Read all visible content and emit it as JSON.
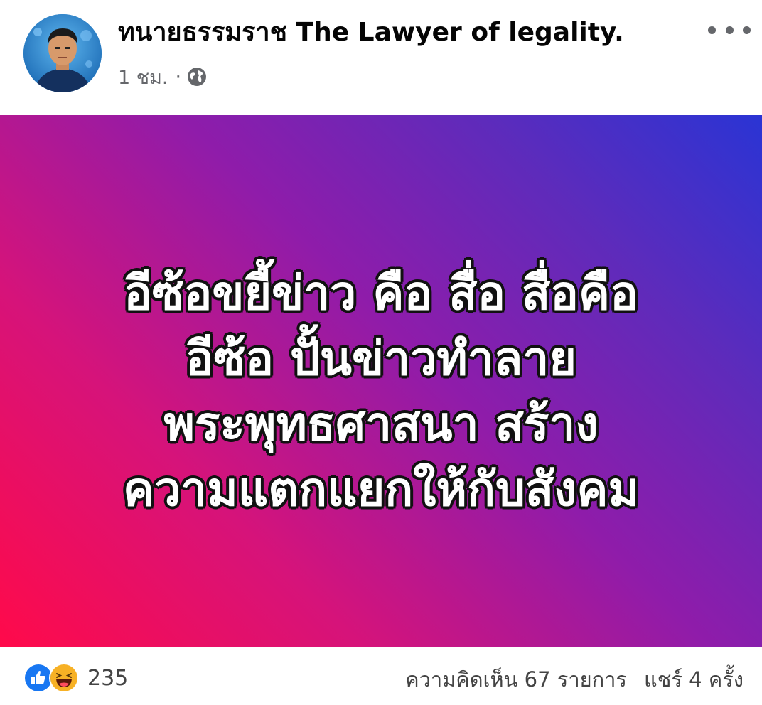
{
  "post": {
    "author_name": "ทนายธรรมราช The Lawyer of  legality.",
    "timestamp": "1 ชม.",
    "separator": "·",
    "audience_icon": "globe-icon",
    "more_icon": "more-options-icon",
    "background_gradient": [
      "#ff0a4a",
      "#8f1caa",
      "#2a34d4"
    ],
    "text_lines": [
      "อีซ้อขยี้ข่าว คือ สื่อ สื่อคือ",
      "อีซ้อ ปั้นข่าวทำลาย",
      "พระพุทธศาสนา สร้าง",
      "ความแตกแยกให้กับสังคม"
    ]
  },
  "footer": {
    "reaction_icons": [
      "like-icon",
      "haha-icon"
    ],
    "reaction_count": "235",
    "comments_text": "ความคิดเห็น 67 รายการ",
    "shares_text": "แชร์ 4 ครั้ง"
  },
  "colors": {
    "like_blue": "#1877f2",
    "haha_yellow": "#f7b125",
    "secondary_text": "#65676b"
  }
}
